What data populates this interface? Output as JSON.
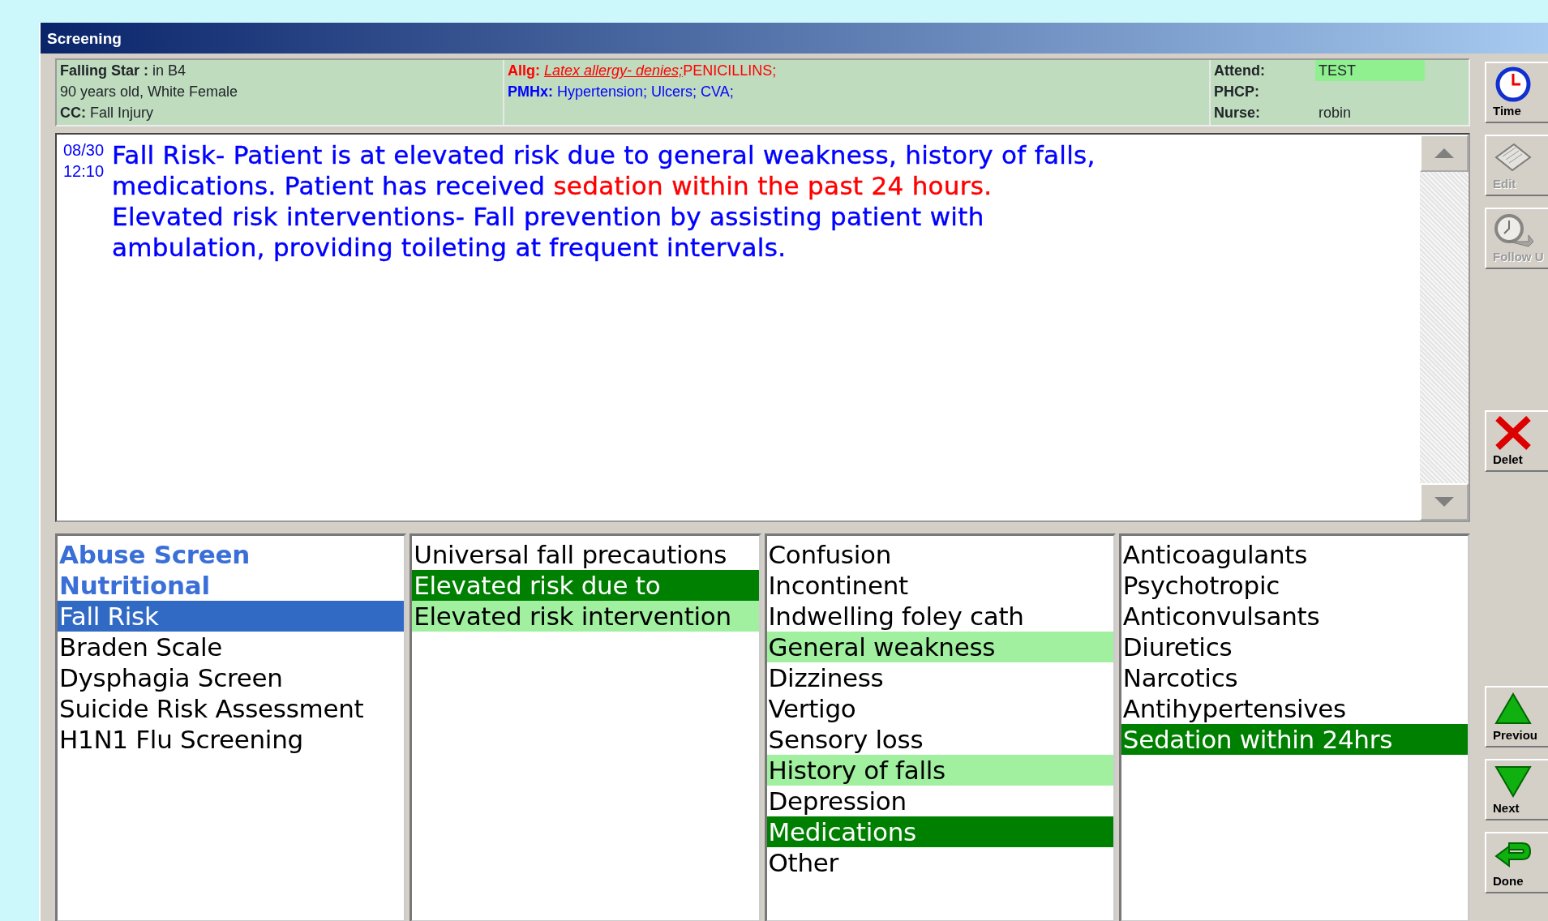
{
  "window": {
    "title": "Screening"
  },
  "patient": {
    "name": "Falling Star :",
    "location": "in B4",
    "demographics": "90 years old, White Female",
    "cc_label": "CC:",
    "cc": "Fall Injury"
  },
  "allergies": {
    "label": "Allg:",
    "items": [
      {
        "text": "Latex allergy- denies;",
        "kind": "denied"
      },
      {
        "text": "PENICILLINS;",
        "kind": "plain"
      }
    ]
  },
  "history": {
    "label": "PMHx:",
    "text": "Hypertension; Ulcers; CVA;"
  },
  "staff": [
    {
      "label": "Attend:",
      "value": "TEST",
      "highlighted": true
    },
    {
      "label": "PHCP:",
      "highlighted": false
    },
    {
      "label": "Nurse:",
      "value": "robin",
      "highlighted": false
    }
  ],
  "note": {
    "date": "08/30",
    "time": "12:10",
    "lines": [
      [
        {
          "text": "Fall Risk- Patient is at elevated risk due to general weakness, history of falls,",
          "alert": false
        }
      ],
      [
        {
          "text": "medications. Patient has received ",
          "alert": false
        },
        {
          "text": "sedation within the past 24 hours.",
          "alert": true
        }
      ],
      [
        {
          "text": "Elevated risk interventions- Fall prevention by assisting patient with",
          "alert": false
        }
      ],
      [
        {
          "text": "ambulation, providing toileting at frequent intervals.",
          "alert": false
        }
      ]
    ]
  },
  "lists": [
    [
      {
        "text": "Abuse Screen",
        "selected": false,
        "done": true,
        "chosen": false,
        "suggested": false
      },
      {
        "text": "Nutritional",
        "selected": false,
        "done": true,
        "chosen": false,
        "suggested": false
      },
      {
        "text": "Fall Risk",
        "selected": true,
        "done": false,
        "chosen": false,
        "suggested": false
      },
      {
        "text": "Braden Scale",
        "selected": false,
        "done": false,
        "chosen": false,
        "suggested": false
      },
      {
        "text": "Dysphagia Screen",
        "selected": false,
        "done": false,
        "chosen": false,
        "suggested": false
      },
      {
        "text": "Suicide Risk Assessment",
        "selected": false,
        "done": false,
        "chosen": false,
        "suggested": false
      },
      {
        "text": "H1N1 Flu Screening",
        "selected": false,
        "done": false,
        "chosen": false,
        "suggested": false
      }
    ],
    [
      {
        "text": "Universal fall precautions",
        "selected": false,
        "done": false,
        "chosen": false,
        "suggested": false
      },
      {
        "text": "Elevated risk due to",
        "selected": false,
        "done": false,
        "chosen": true,
        "suggested": false
      },
      {
        "text": "Elevated risk intervention",
        "selected": false,
        "done": false,
        "chosen": false,
        "suggested": true
      }
    ],
    [
      {
        "text": "Confusion",
        "selected": false,
        "done": false,
        "chosen": false,
        "suggested": false
      },
      {
        "text": "Incontinent",
        "selected": false,
        "done": false,
        "chosen": false,
        "suggested": false
      },
      {
        "text": "Indwelling foley cath",
        "selected": false,
        "done": false,
        "chosen": false,
        "suggested": false
      },
      {
        "text": "General weakness",
        "selected": false,
        "done": false,
        "chosen": false,
        "suggested": true
      },
      {
        "text": "Dizziness",
        "selected": false,
        "done": false,
        "chosen": false,
        "suggested": false
      },
      {
        "text": "Vertigo",
        "selected": false,
        "done": false,
        "chosen": false,
        "suggested": false
      },
      {
        "text": "Sensory loss",
        "selected": false,
        "done": false,
        "chosen": false,
        "suggested": false
      },
      {
        "text": "History of falls",
        "selected": false,
        "done": false,
        "chosen": false,
        "suggested": true
      },
      {
        "text": "Depression",
        "selected": false,
        "done": false,
        "chosen": false,
        "suggested": false
      },
      {
        "text": "Medications",
        "selected": false,
        "done": false,
        "chosen": true,
        "suggested": false
      },
      {
        "text": "Other",
        "selected": false,
        "done": false,
        "chosen": false,
        "suggested": false
      }
    ],
    [
      {
        "text": "Anticoagulants",
        "selected": false,
        "done": false,
        "chosen": false,
        "suggested": false
      },
      {
        "text": "Psychotropic",
        "selected": false,
        "done": false,
        "chosen": false,
        "suggested": false
      },
      {
        "text": "Anticonvulsants",
        "selected": false,
        "done": false,
        "chosen": false,
        "suggested": false
      },
      {
        "text": "Diuretics",
        "selected": false,
        "done": false,
        "chosen": false,
        "suggested": false
      },
      {
        "text": "Narcotics",
        "selected": false,
        "done": false,
        "chosen": false,
        "suggested": false
      },
      {
        "text": "Antihypertensives",
        "selected": false,
        "done": false,
        "chosen": false,
        "suggested": false
      },
      {
        "text": "Sedation within 24hrs",
        "selected": false,
        "done": false,
        "chosen": true,
        "suggested": false
      }
    ]
  ],
  "toolbar": [
    {
      "label": "Time",
      "kind": "clock",
      "disabled": false
    },
    {
      "label": "Edit",
      "kind": "notepad",
      "disabled": true
    },
    {
      "label": "Follow U",
      "kind": "followup",
      "disabled": true
    },
    {
      "label": "Delet",
      "kind": "delete",
      "disabled": false
    },
    {
      "label": "Previou",
      "kind": "up",
      "disabled": false
    },
    {
      "label": "Next",
      "kind": "down",
      "disabled": false
    },
    {
      "label": "Done",
      "kind": "done",
      "disabled": false
    }
  ]
}
